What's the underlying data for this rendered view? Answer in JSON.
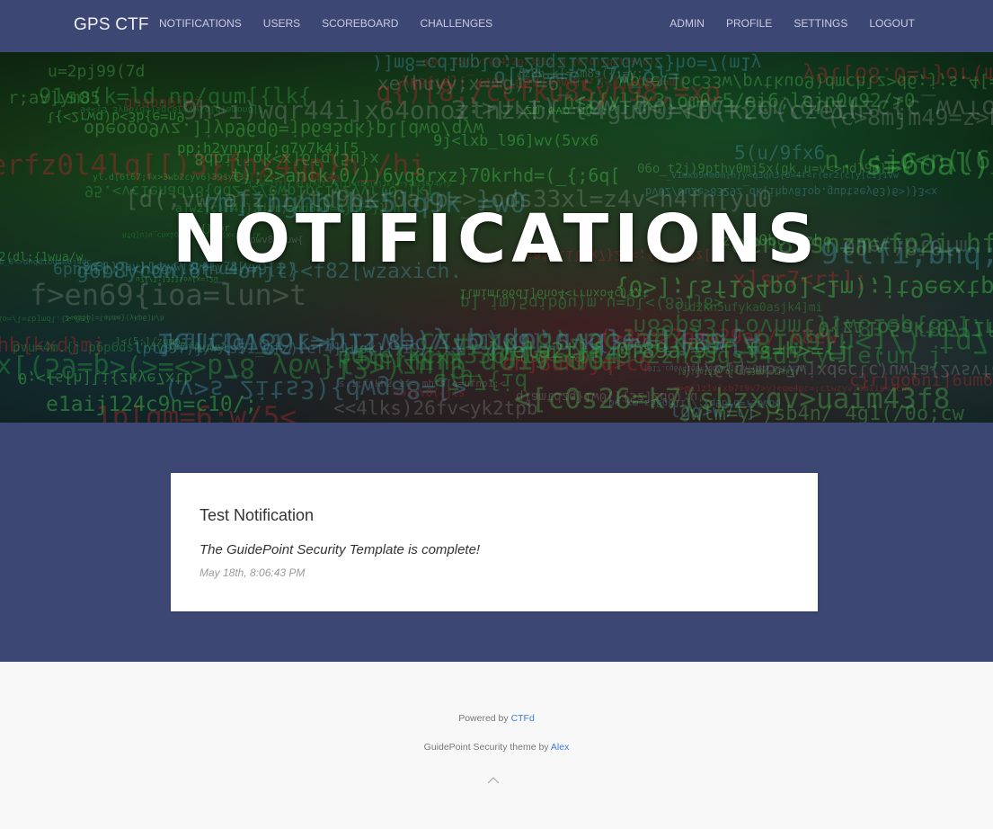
{
  "navbar": {
    "brand": "GPS CTF",
    "left_items": [
      "NOTIFICATIONS",
      "USERS",
      "SCOREBOARD",
      "CHALLENGES"
    ],
    "right_items": [
      "ADMIN",
      "PROFILE",
      "SETTINGS",
      "LOGOUT"
    ],
    "background": "#3d4774"
  },
  "hero": {
    "title": "NOTIFICATIONS"
  },
  "notification": {
    "title": "Test Notification",
    "body": "The GuidePoint Security Template is complete!",
    "timestamp": "May 18th, 8:06:43 PM"
  },
  "footer": {
    "powered_by_text": "Powered by",
    "powered_by_link": "CTFd",
    "theme_text": "GuidePoint Security theme by",
    "theme_link": "Alex",
    "back_to_top_icon": "chevron-up-icon",
    "link_color": "#3b7ddd"
  }
}
